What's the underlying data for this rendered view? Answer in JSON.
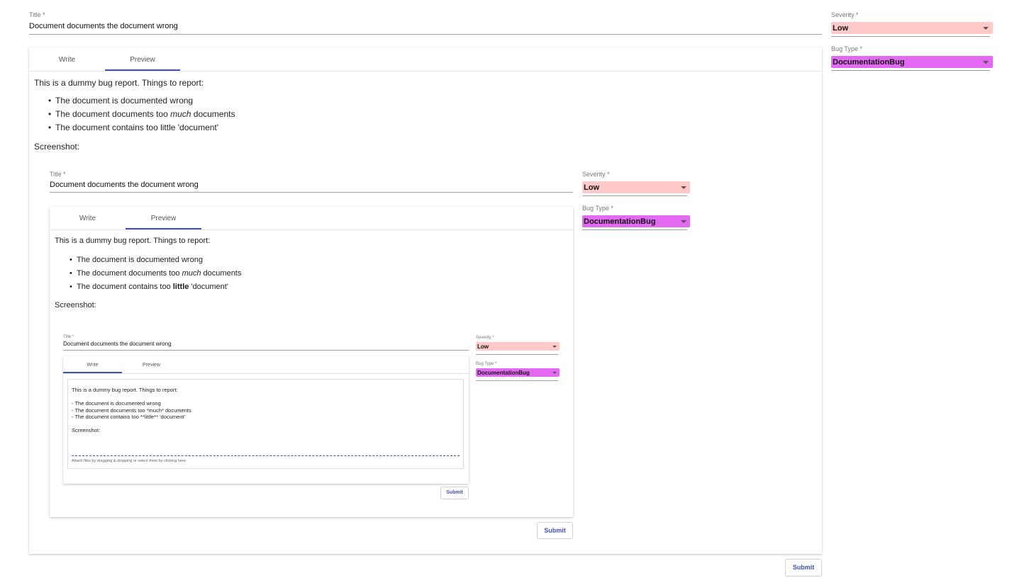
{
  "form": {
    "title_label": "Title *",
    "title_value": "Document documents the document wrong",
    "severity_label": "Severity *",
    "severity_value": "Low",
    "bugtype_label": "Bug Type *",
    "bugtype_value": "DocumentationBug",
    "tab_write": "Write",
    "tab_preview": "Preview",
    "submit_label": "Submit"
  },
  "preview": {
    "intro": "This is a dummy bug report. Things to report:",
    "item1": "The document is documented wrong",
    "item2_a": "The document documents too ",
    "item2_em": "much",
    "item2_b": " documents",
    "item3_a": "The document contains too little 'document'",
    "item3_mid_a": "The document contains too ",
    "item3_mid_strong": "little",
    "item3_mid_b": " 'document'",
    "screenshot_label": "Screenshot:"
  },
  "editor": {
    "text": "This is a dummy bug report. Things to report:\n\n- The document is documented wrong\n- The document documents too *much* documents\n- The document contains too **little** 'document'\n\nScreenshot:",
    "attach_hint": "Attach files by dragging & dropping or select them by clicking here."
  },
  "colors": {
    "severity_bg": "#ffc9c9",
    "bugtype_bg": "#e369f2",
    "accent": "#3f51b5"
  }
}
